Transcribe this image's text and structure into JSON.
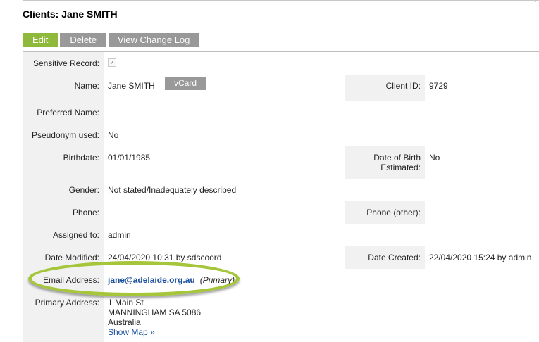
{
  "page": {
    "title": "Clients: Jane SMITH"
  },
  "toolbar": {
    "edit": "Edit",
    "delete": "Delete",
    "change_log": "View Change Log"
  },
  "fields": {
    "sensitive": {
      "label": "Sensitive Record:",
      "checked": "✓"
    },
    "name": {
      "label": "Name:",
      "value": "Jane SMITH",
      "vcard": "vCard"
    },
    "client_id": {
      "label": "Client ID:",
      "value": "9729"
    },
    "preferred_name": {
      "label": "Preferred Name:",
      "value": ""
    },
    "pseudonym": {
      "label": "Pseudonym used:",
      "value": "No"
    },
    "birthdate": {
      "label": "Birthdate:",
      "value": "01/01/1985"
    },
    "dob_estimated": {
      "label_line1": "Date of Birth",
      "label_line2": "Estimated:",
      "value": "No"
    },
    "gender": {
      "label": "Gender:",
      "value": "Not stated/Inadequately described"
    },
    "phone": {
      "label": "Phone:",
      "value": ""
    },
    "phone_other": {
      "label": "Phone (other):",
      "value": ""
    },
    "assigned_to": {
      "label": "Assigned to:",
      "value": "admin"
    },
    "date_modified": {
      "label": "Date Modified:",
      "value": "24/04/2020 10:31 by sdscoord"
    },
    "date_created": {
      "label": "Date Created:",
      "value": "22/04/2020 15:24 by admin"
    },
    "email": {
      "label": "Email Address:",
      "value": "jane@adelaide.org.au",
      "tag": "(Primary)"
    },
    "address": {
      "label": "Primary Address:",
      "line1": "1 Main St",
      "line2": "MANNINGHAM SA  5086",
      "line3": "Australia",
      "map_link": "Show Map »"
    }
  },
  "colors": {
    "edit_button": "#8fb93a",
    "grey_button": "#999999",
    "highlight_ellipse": "#a5c63a",
    "link": "#1a4f9c"
  }
}
